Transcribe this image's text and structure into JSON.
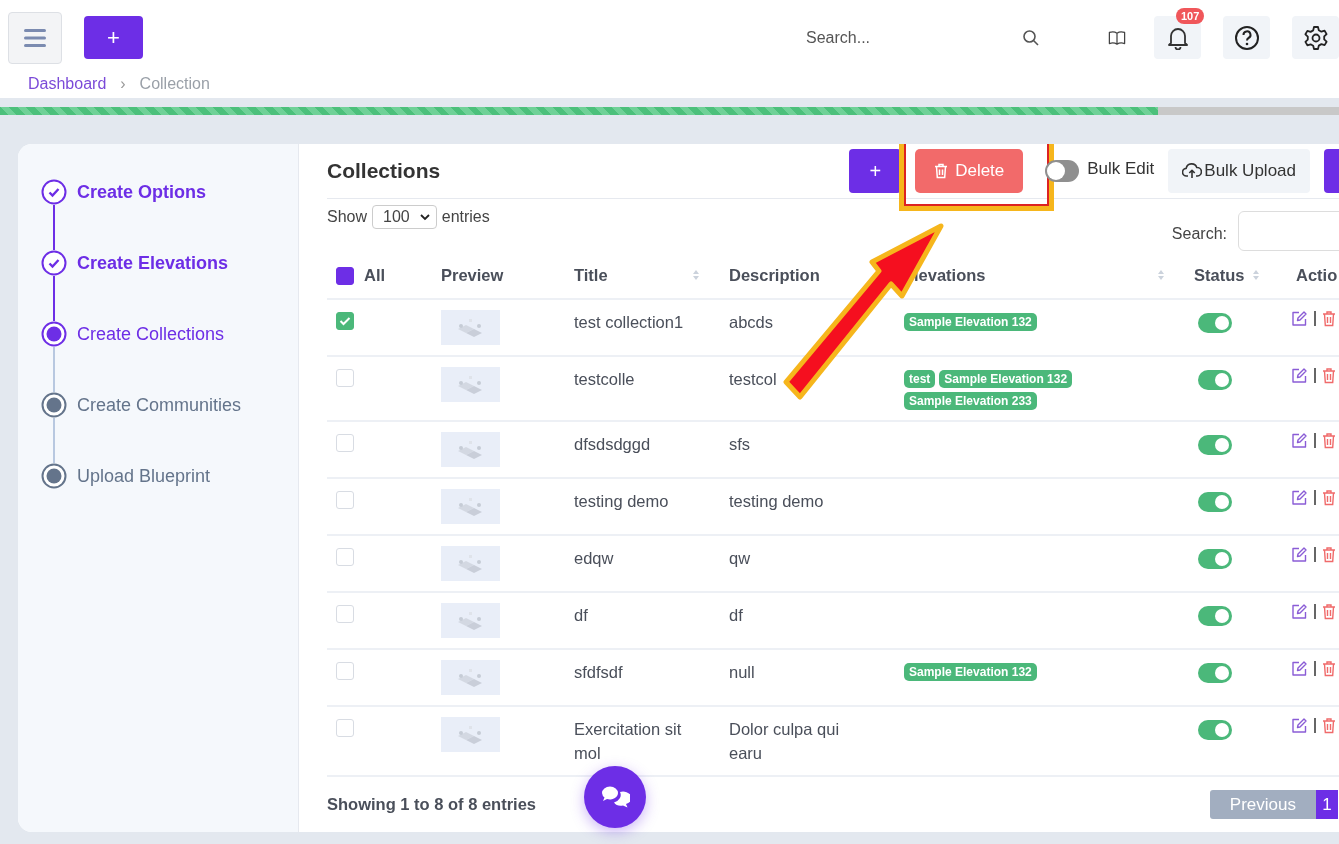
{
  "topbar": {
    "add_button": "+",
    "search": {
      "placeholder": "Search..."
    },
    "notifications": "107"
  },
  "breadcrumb": {
    "items": [
      "Dashboard",
      "Collection"
    ],
    "separator": "›"
  },
  "progress": {
    "level": 0.865
  },
  "steps": [
    {
      "label": "Create Options",
      "kind": "done"
    },
    {
      "label": "Create Elevations",
      "kind": "done"
    },
    {
      "label": "Create Collections",
      "kind": "current"
    },
    {
      "label": "Create Communities",
      "kind": "pending"
    },
    {
      "label": "Upload Blueprint",
      "kind": "pending"
    }
  ],
  "panel": {
    "title": "Collections",
    "add_button": "+",
    "delete_button": "Delete",
    "bulk_edit": {
      "label": "Bulk Edit",
      "on": false
    },
    "bulk_upload": "Bulk Upload",
    "length": {
      "before": "Show",
      "value": "100",
      "after": "entries"
    },
    "search_label": "Search:"
  },
  "table": {
    "select_all": {
      "label": "All",
      "checked": true
    },
    "columns": [
      {
        "label": "Preview",
        "sortable": false
      },
      {
        "label": "Title",
        "sortable": true
      },
      {
        "label": "Description",
        "sortable": false
      },
      {
        "label": "levations",
        "sortable": true
      },
      {
        "label": "Status",
        "sortable": true
      },
      {
        "label": "Actio",
        "sortable": false
      }
    ],
    "rows": [
      {
        "checked": true,
        "title": "test collection1",
        "description": "abcds",
        "elevations": [
          "Sample Elevation 132"
        ],
        "on": true
      },
      {
        "checked": false,
        "title": "testcolle",
        "description": "testcol",
        "elevations": [
          "test",
          "Sample Elevation 132",
          "Sample Elevation 233"
        ],
        "on": true
      },
      {
        "checked": false,
        "title": "dfsdsdggd",
        "description": "sfs",
        "elevations": [],
        "on": true
      },
      {
        "checked": false,
        "title": "testing demo",
        "description": "testing demo",
        "elevations": [],
        "on": true
      },
      {
        "checked": false,
        "title": "edqw",
        "description": "qw",
        "elevations": [],
        "on": true
      },
      {
        "checked": false,
        "title": "df",
        "description": "df",
        "elevations": [],
        "on": true
      },
      {
        "checked": false,
        "title": "sfdfsdf",
        "description": "null",
        "elevations": [
          "Sample Elevation 132"
        ],
        "on": true
      },
      {
        "checked": false,
        "title": "Exercitation sit mol",
        "description": "Dolor culpa qui earu",
        "elevations": [],
        "on": true
      }
    ]
  },
  "footer": {
    "info": "Showing 1 to 8 of 8 entries",
    "previous": "Previous",
    "pages": [
      {
        "label": "1",
        "selected": true
      }
    ]
  }
}
